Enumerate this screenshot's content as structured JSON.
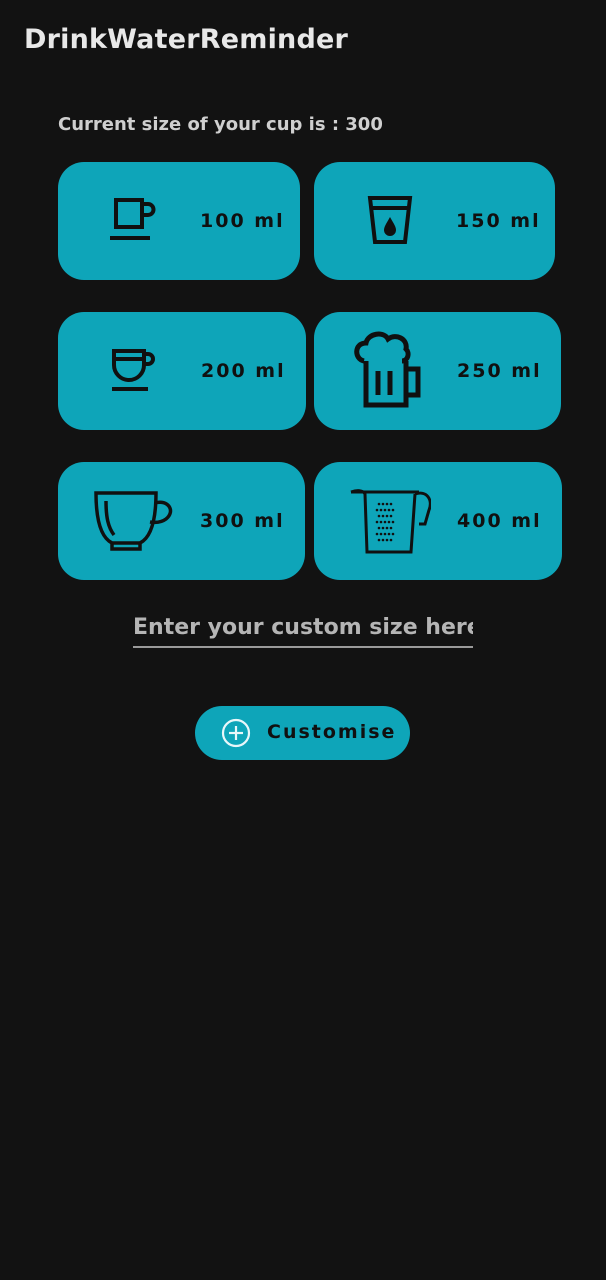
{
  "app": {
    "title": "DrinkWaterReminder"
  },
  "current_cup": {
    "text": "Current size of your cup is : 300"
  },
  "cups": [
    {
      "label": "100 ml",
      "icon": "coffee-cup-saucer-icon"
    },
    {
      "label": "150 ml",
      "icon": "water-glass-drop-icon"
    },
    {
      "label": "200 ml",
      "icon": "espresso-cup-icon"
    },
    {
      "label": "250 ml",
      "icon": "beer-mug-icon"
    },
    {
      "label": "300 ml",
      "icon": "tea-cup-icon"
    },
    {
      "label": "400 ml",
      "icon": "measuring-jug-icon"
    }
  ],
  "custom": {
    "placeholder": "Enter your custom size here",
    "button_label": "Customise",
    "button_icon": "plus-circle-icon"
  },
  "colors": {
    "background": "#121212",
    "accent": "#0ea5b9",
    "text_primary": "#e8e8e8",
    "text_dark": "#101010"
  }
}
